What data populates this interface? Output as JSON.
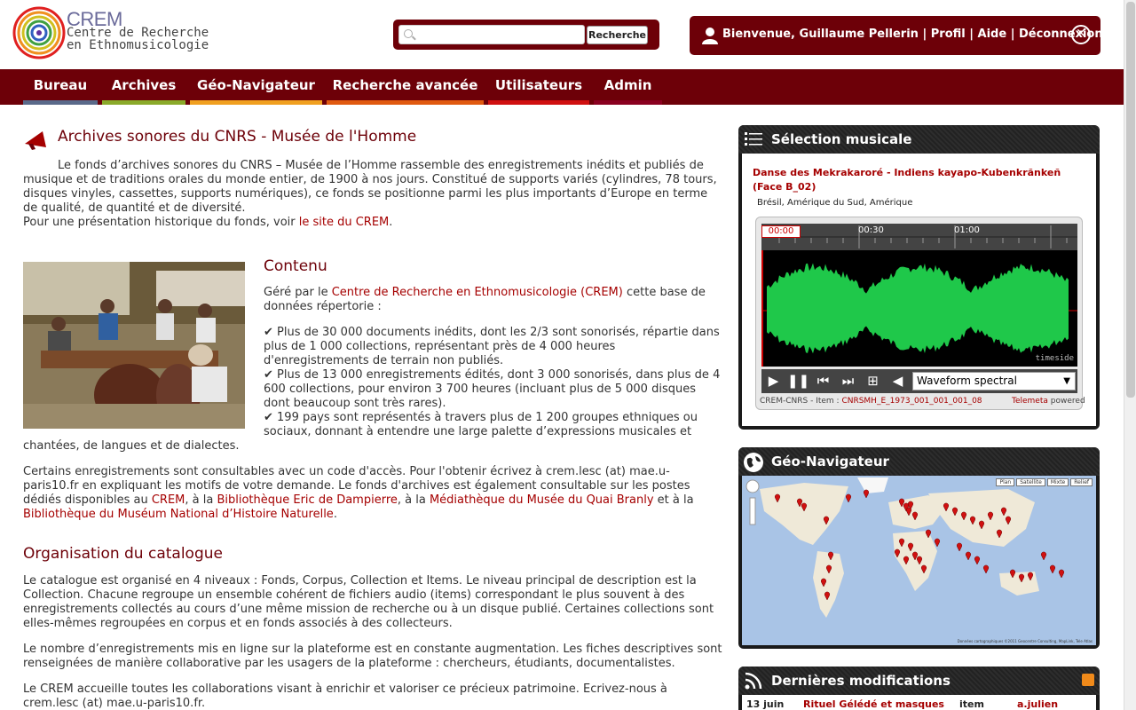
{
  "header": {
    "logo_title": "CREM",
    "logo_line1": "Centre de Recherche",
    "logo_line2": "en Ethnomusicologie",
    "search_placeholder": "",
    "search_button": "Recherche",
    "welcome": "Bienvenue, Guillaume Pellerin",
    "profil": "Profil",
    "aide": "Aide",
    "deconnexion": "Déconnexion",
    "separator": "|"
  },
  "nav": [
    {
      "label": "Bureau",
      "color": "#5a6a8a"
    },
    {
      "label": "Archives",
      "color": "#8aaa2a"
    },
    {
      "label": "Géo-Navigateur",
      "color": "#f0a020"
    },
    {
      "label": "Recherche avancée",
      "color": "#e05a10"
    },
    {
      "label": "Utilisateurs",
      "color": "#d01010"
    },
    {
      "label": "Admin",
      "color": "#8a0020"
    }
  ],
  "main": {
    "title": "Archives sonores du CNRS - Musée de l'Homme",
    "intro": "Le fonds d’archives sonores du CNRS – Musée de l’Homme rassemble des enregistrements inédits et publiés de musique et de traditions orales du monde entier, de 1900 à nos jours. Constitué de supports variés (cylindres, 78 tours, disques vinyles, cassettes, supports numériques), ce fonds se positionne parmi les plus importants d’Europe en terme de qualité, de quantité et de diversité.",
    "intro2_pre": "Pour une présentation historique du fonds, voir ",
    "intro2_link": "le site du CREM",
    "intro2_post": ".",
    "contenu_title": "Contenu",
    "contenu_pre": "Géré par le ",
    "contenu_link": "Centre de Recherche en Ethnomusicologie (CREM)",
    "contenu_post": " cette base de données répertorie :",
    "bullet1": "✔ Plus de 30 000 documents inédits, dont les 2/3 sont sonorisés, répartie dans plus de 1 000 collections, représentant près de 4 000 heures d'enregistrements de terrain non publiés.",
    "bullet2": "✔ Plus de 13 000 enregistrements édités, dont 3 000 sonorisés, dans plus de 4 600 collections, pour environ 3 700 heures (incluant plus de 5 000 disques dont beaucoup sont très rares).",
    "bullet3_a": "✔ 199 pays sont représentés à travers plus de 1 200 groupes ethniques ou sociaux, donnant à entendre une large palette d’expressions musicales et",
    "bullet3_b": "chantées, de langues et de dialectes.",
    "access_1": "Certains enregistrements sont consultables avec un code d'accès. Pour l'obtenir écrivez à crem.lesc (at) mae.u-paris10.fr en expliquant les motifs de votre demande. Le fonds d'archives est également consultable sur les postes dédiés disponibles au ",
    "access_crem": "CREM",
    "access_2": ", à la ",
    "access_bib1": "Bibliothèque Eric de Dampierre",
    "access_3": ", à la ",
    "access_bib2": "Médiathèque du Musée du Quai Branly",
    "access_4": " et à la ",
    "access_bib3": "Bibliothèque du Muséum National d’Histoire Naturelle",
    "access_5": ".",
    "org_title": "Organisation du catalogue",
    "org_p1": "Le catalogue est organisé en 4 niveaux : Fonds, Corpus, Collection et Items. Le niveau principal de description est la Collection. Chacune regroupe un ensemble cohérent de fichiers audio (items) correspondant le plus souvent à des enregistrements collectés au cours d’une même mission de recherche ou à un disque publié. Certaines collections sont elles-mêmes regroupées en corpus et en fonds associés à des collecteurs.",
    "org_p2": "Le nombre d’enregistrements mis en ligne sur la plateforme est en constante augmentation. Les fiches descriptives sont renseignées de manière collaborative par les usagers de la plateforme : chercheurs, étudiants, documentalistes.",
    "org_p3": "Le CREM accueille toutes les collaborations visant à enrichir et valoriser ce précieux patrimoine. Ecrivez-nous à crem.lesc (at) mae.u-paris10.fr."
  },
  "sidebar": {
    "selection_title": "Sélection musicale",
    "track_title": "Danse des Mekrakaroré - Indiens kayapo-Kubenkrãnkeñ (Face B_02)",
    "track_location": "Brésil, Amérique du Sud, Amérique",
    "time_current": "00:00",
    "tick_1": "00:30",
    "tick_2": "01:00",
    "timeside": "timeside",
    "view_select": "Waveform spectral",
    "footer_left": "CREM-CNRS - Item : ",
    "footer_code": "CNRSMH_E_1973_001_001_001_08",
    "footer_telemeta": "Telemeta",
    "footer_powered": "powered",
    "geo_title": "Géo-Navigateur",
    "map_credits": "Données cartographiques ©2011 Geocentre Consulting, MapLink, Tele Atlas",
    "map_btn1": "Plan",
    "map_btn2": "Satellite",
    "map_btn3": "Mixte",
    "map_btn4": "Relief",
    "modif_title": "Dernières modifications",
    "modif_date": "13 juin",
    "modif_item": "Rituel Gélédé et masques",
    "modif_type": "item",
    "modif_user": "a.julien"
  },
  "colors": {
    "brand": "#6d0008",
    "link": "#a50000",
    "waveform": "#22dd55"
  }
}
